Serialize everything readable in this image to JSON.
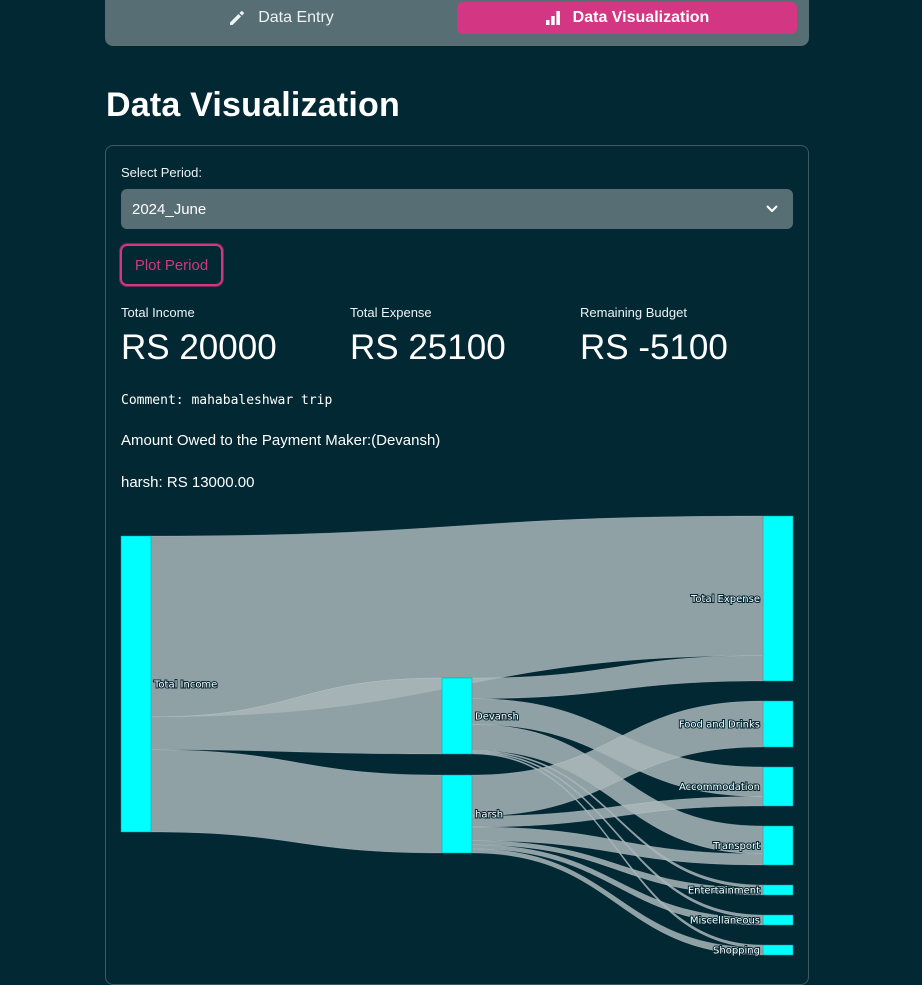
{
  "nav": {
    "entry_label": "Data Entry",
    "visualization_label": "Data Visualization",
    "entry_icon": "pencil-icon",
    "visualization_icon": "bar-chart-icon",
    "active_color": "#d33682"
  },
  "page": {
    "title": "Data Visualization"
  },
  "period": {
    "label": "Select Period:",
    "selected": "2024_June",
    "plot_button": "Plot Period"
  },
  "metrics": {
    "income_label": "Total Income",
    "income_value": "RS 20000",
    "expense_label": "Total Expense",
    "expense_value": "RS 25100",
    "remaining_label": "Remaining Budget",
    "remaining_value": "RS -5100"
  },
  "comment": "Comment: mahabaleshwar trip",
  "owed": {
    "heading": "Amount Owed to the Payment Maker:(Devansh)",
    "entry": "harsh: RS 13000.00"
  },
  "chart_data": {
    "type": "sankey",
    "node_color": "#00ffff",
    "link_color": "#a9b6ba",
    "nodes": [
      "Total Income",
      "Devansh",
      "harsh",
      "Total Expense",
      "Food and Drinks",
      "Accommodation",
      "Transport",
      "Entertainment",
      "Miscellaneous",
      "Shopping"
    ],
    "links": [
      {
        "source": "Total Income",
        "target": "Total Expense",
        "value": 11000
      },
      {
        "source": "Total Income",
        "target": "Devansh",
        "value": 2000
      },
      {
        "source": "Total Income",
        "target": "harsh",
        "value": 5000
      },
      {
        "source": "Devansh",
        "target": "Total Expense",
        "value": 2000
      },
      {
        "source": "Devansh",
        "target": "Accommodation",
        "value": 2500
      },
      {
        "source": "Devansh",
        "target": "Transport",
        "value": 2500
      },
      {
        "source": "Devansh",
        "target": "Entertainment",
        "value": 120
      },
      {
        "source": "Devansh",
        "target": "Miscellaneous",
        "value": 120
      },
      {
        "source": "Devansh",
        "target": "Shopping",
        "value": 120
      },
      {
        "source": "harsh",
        "target": "Food and Drinks",
        "value": 3000
      },
      {
        "source": "harsh",
        "target": "Accommodation",
        "value": 800
      },
      {
        "source": "harsh",
        "target": "Transport",
        "value": 1000
      },
      {
        "source": "harsh",
        "target": "Entertainment",
        "value": 300
      },
      {
        "source": "harsh",
        "target": "Miscellaneous",
        "value": 300
      },
      {
        "source": "harsh",
        "target": "Shopping",
        "value": 300
      }
    ]
  }
}
